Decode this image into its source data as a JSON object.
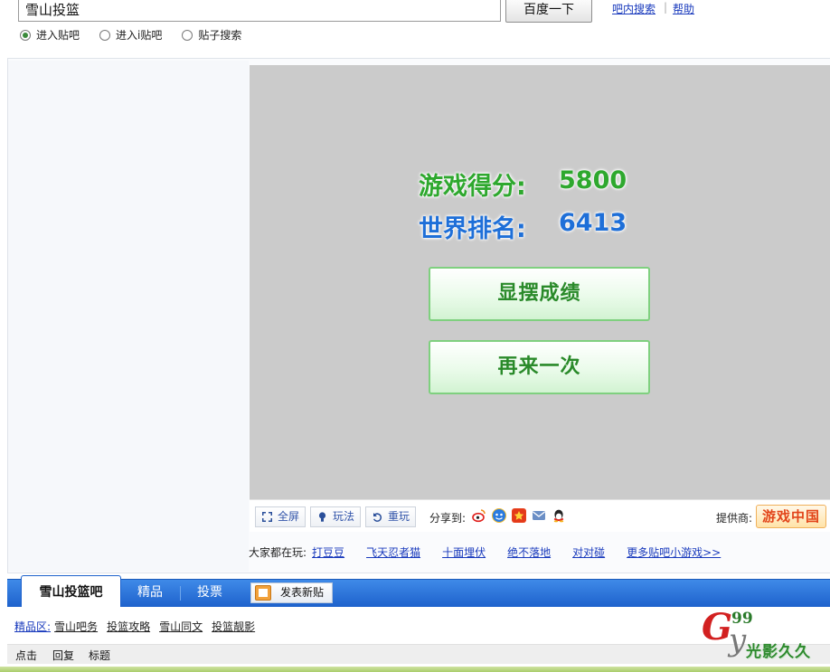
{
  "search": {
    "query": "雪山投篮",
    "button_label": "百度一下",
    "link_bar_search": "吧内搜索",
    "link_help": "帮助",
    "separator": "|",
    "radio_options": [
      "进入贴吧",
      "进入i贴吧",
      "贴子搜索"
    ],
    "selected_radio": "进入贴吧"
  },
  "game": {
    "score_label": "游戏得分:",
    "score_value": "5800",
    "rank_label": "世界排名:",
    "rank_value": "6413",
    "show_button": "显摆成绩",
    "again_button": "再来一次",
    "toolbar": {
      "fullscreen": "全屏",
      "howto": "玩法",
      "replay": "重玩",
      "share_label": "分享到:",
      "share_icons": [
        "weibo-icon",
        "renren-icon",
        "kaixin-icon",
        "mail-icon",
        "qq-icon"
      ],
      "provider_label": "提供商:",
      "provider_name": "游戏中国"
    },
    "playing": {
      "label": "大家都在玩:",
      "games": [
        "打豆豆",
        "飞天忍者猫",
        "十面埋伏",
        "绝不落地",
        "对对碰",
        "更多贴吧小游戏>>"
      ]
    }
  },
  "bar": {
    "active_tab": "雪山投篮吧",
    "tab_featured": "精品",
    "tab_vote": "投票",
    "post_button": "发表新贴"
  },
  "featured": {
    "label": "精品区:",
    "links": [
      "雪山吧务",
      "投篮攻略",
      "雪山同文",
      "投篮靓影"
    ]
  },
  "list_header": {
    "col_clicks": "点击",
    "col_replies": "回复",
    "col_title": "标题"
  },
  "watermark": {
    "big_letter": "G",
    "number": "99",
    "small_letter": "y",
    "text": "光影久久"
  },
  "colors": {
    "score_green": "#2ea82e",
    "rank_blue": "#1e6fd8",
    "nav_blue": "#1e62cc",
    "link_blue": "#1a3bbd",
    "game_bg": "#cbcbcb"
  }
}
